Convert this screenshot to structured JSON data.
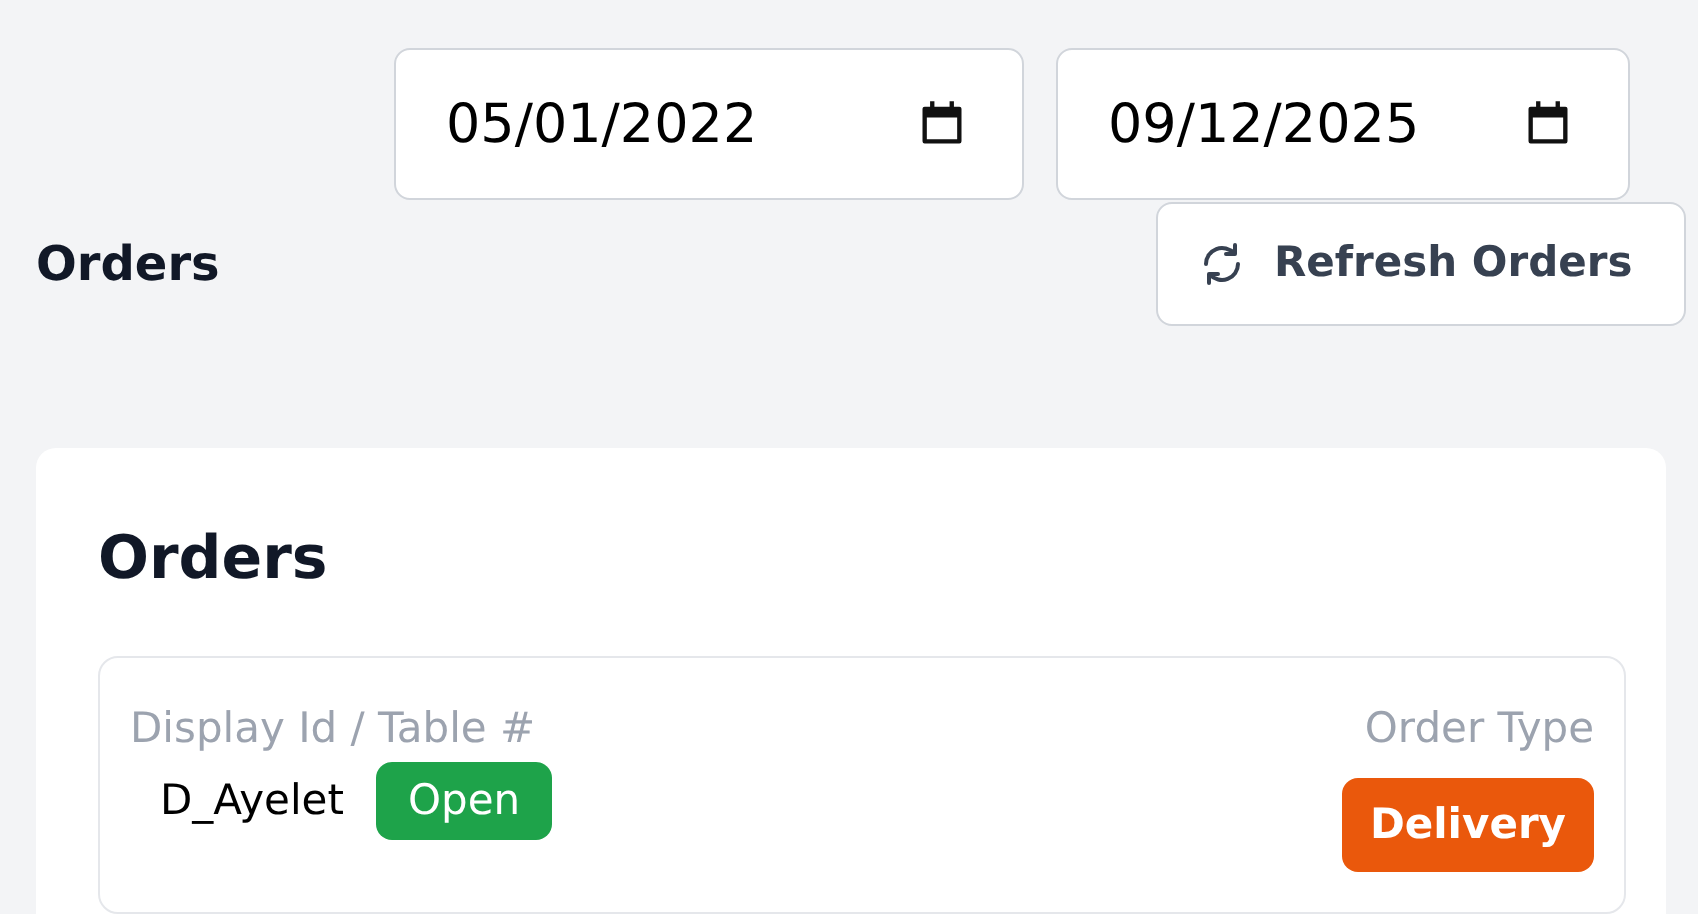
{
  "date_range": [
    {
      "value": "05/01/2022"
    },
    {
      "value": "09/12/2025"
    }
  ],
  "page_title": "Orders",
  "refresh_button": {
    "label": "Refresh Orders"
  },
  "orders_card": {
    "title": "Orders",
    "orders": [
      {
        "id_label": "Display Id / Table #",
        "display_id": "D_Ayelet",
        "status": {
          "label": "Open",
          "kind": "open"
        },
        "type_label": "Order Type",
        "order_type": {
          "label": "Delivery",
          "kind": "delivery"
        }
      }
    ]
  }
}
